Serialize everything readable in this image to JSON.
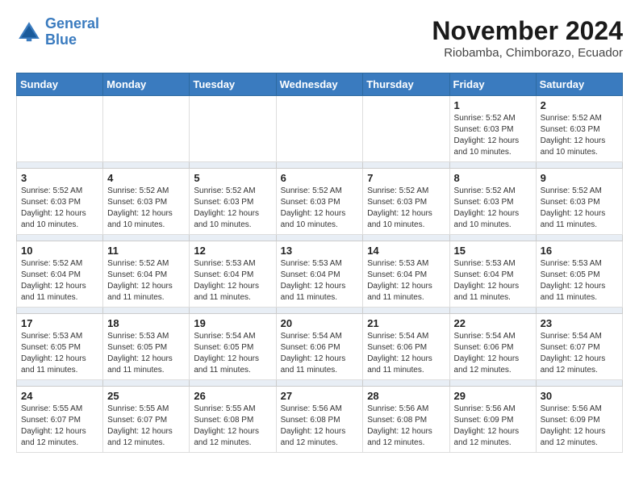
{
  "logo": {
    "line1": "General",
    "line2": "Blue"
  },
  "title": "November 2024",
  "location": "Riobamba, Chimborazo, Ecuador",
  "days_header": [
    "Sunday",
    "Monday",
    "Tuesday",
    "Wednesday",
    "Thursday",
    "Friday",
    "Saturday"
  ],
  "weeks": [
    {
      "days": [
        {
          "num": "",
          "info": ""
        },
        {
          "num": "",
          "info": ""
        },
        {
          "num": "",
          "info": ""
        },
        {
          "num": "",
          "info": ""
        },
        {
          "num": "",
          "info": ""
        },
        {
          "num": "1",
          "info": "Sunrise: 5:52 AM\nSunset: 6:03 PM\nDaylight: 12 hours\nand 10 minutes."
        },
        {
          "num": "2",
          "info": "Sunrise: 5:52 AM\nSunset: 6:03 PM\nDaylight: 12 hours\nand 10 minutes."
        }
      ]
    },
    {
      "days": [
        {
          "num": "3",
          "info": "Sunrise: 5:52 AM\nSunset: 6:03 PM\nDaylight: 12 hours\nand 10 minutes."
        },
        {
          "num": "4",
          "info": "Sunrise: 5:52 AM\nSunset: 6:03 PM\nDaylight: 12 hours\nand 10 minutes."
        },
        {
          "num": "5",
          "info": "Sunrise: 5:52 AM\nSunset: 6:03 PM\nDaylight: 12 hours\nand 10 minutes."
        },
        {
          "num": "6",
          "info": "Sunrise: 5:52 AM\nSunset: 6:03 PM\nDaylight: 12 hours\nand 10 minutes."
        },
        {
          "num": "7",
          "info": "Sunrise: 5:52 AM\nSunset: 6:03 PM\nDaylight: 12 hours\nand 10 minutes."
        },
        {
          "num": "8",
          "info": "Sunrise: 5:52 AM\nSunset: 6:03 PM\nDaylight: 12 hours\nand 10 minutes."
        },
        {
          "num": "9",
          "info": "Sunrise: 5:52 AM\nSunset: 6:03 PM\nDaylight: 12 hours\nand 11 minutes."
        }
      ]
    },
    {
      "days": [
        {
          "num": "10",
          "info": "Sunrise: 5:52 AM\nSunset: 6:04 PM\nDaylight: 12 hours\nand 11 minutes."
        },
        {
          "num": "11",
          "info": "Sunrise: 5:52 AM\nSunset: 6:04 PM\nDaylight: 12 hours\nand 11 minutes."
        },
        {
          "num": "12",
          "info": "Sunrise: 5:53 AM\nSunset: 6:04 PM\nDaylight: 12 hours\nand 11 minutes."
        },
        {
          "num": "13",
          "info": "Sunrise: 5:53 AM\nSunset: 6:04 PM\nDaylight: 12 hours\nand 11 minutes."
        },
        {
          "num": "14",
          "info": "Sunrise: 5:53 AM\nSunset: 6:04 PM\nDaylight: 12 hours\nand 11 minutes."
        },
        {
          "num": "15",
          "info": "Sunrise: 5:53 AM\nSunset: 6:04 PM\nDaylight: 12 hours\nand 11 minutes."
        },
        {
          "num": "16",
          "info": "Sunrise: 5:53 AM\nSunset: 6:05 PM\nDaylight: 12 hours\nand 11 minutes."
        }
      ]
    },
    {
      "days": [
        {
          "num": "17",
          "info": "Sunrise: 5:53 AM\nSunset: 6:05 PM\nDaylight: 12 hours\nand 11 minutes."
        },
        {
          "num": "18",
          "info": "Sunrise: 5:53 AM\nSunset: 6:05 PM\nDaylight: 12 hours\nand 11 minutes."
        },
        {
          "num": "19",
          "info": "Sunrise: 5:54 AM\nSunset: 6:05 PM\nDaylight: 12 hours\nand 11 minutes."
        },
        {
          "num": "20",
          "info": "Sunrise: 5:54 AM\nSunset: 6:06 PM\nDaylight: 12 hours\nand 11 minutes."
        },
        {
          "num": "21",
          "info": "Sunrise: 5:54 AM\nSunset: 6:06 PM\nDaylight: 12 hours\nand 11 minutes."
        },
        {
          "num": "22",
          "info": "Sunrise: 5:54 AM\nSunset: 6:06 PM\nDaylight: 12 hours\nand 12 minutes."
        },
        {
          "num": "23",
          "info": "Sunrise: 5:54 AM\nSunset: 6:07 PM\nDaylight: 12 hours\nand 12 minutes."
        }
      ]
    },
    {
      "days": [
        {
          "num": "24",
          "info": "Sunrise: 5:55 AM\nSunset: 6:07 PM\nDaylight: 12 hours\nand 12 minutes."
        },
        {
          "num": "25",
          "info": "Sunrise: 5:55 AM\nSunset: 6:07 PM\nDaylight: 12 hours\nand 12 minutes."
        },
        {
          "num": "26",
          "info": "Sunrise: 5:55 AM\nSunset: 6:08 PM\nDaylight: 12 hours\nand 12 minutes."
        },
        {
          "num": "27",
          "info": "Sunrise: 5:56 AM\nSunset: 6:08 PM\nDaylight: 12 hours\nand 12 minutes."
        },
        {
          "num": "28",
          "info": "Sunrise: 5:56 AM\nSunset: 6:08 PM\nDaylight: 12 hours\nand 12 minutes."
        },
        {
          "num": "29",
          "info": "Sunrise: 5:56 AM\nSunset: 6:09 PM\nDaylight: 12 hours\nand 12 minutes."
        },
        {
          "num": "30",
          "info": "Sunrise: 5:56 AM\nSunset: 6:09 PM\nDaylight: 12 hours\nand 12 minutes."
        }
      ]
    }
  ]
}
